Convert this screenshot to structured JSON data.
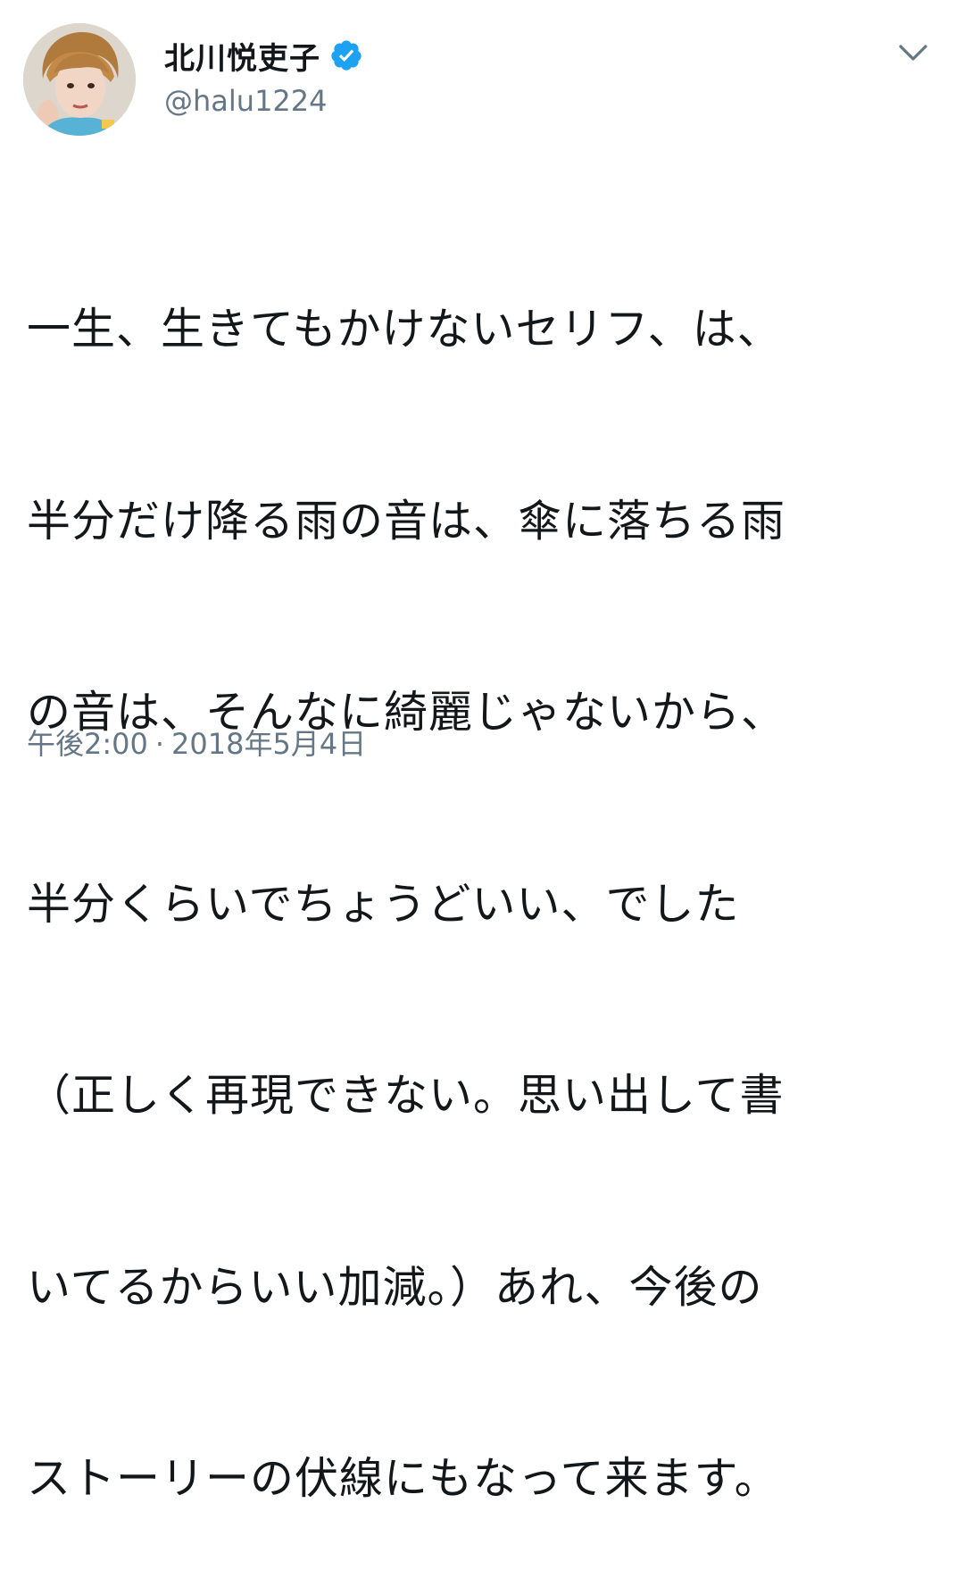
{
  "user": {
    "display_name": "北川悦吏子",
    "handle": "@halu1224",
    "verified": true
  },
  "tweet": {
    "lines": [
      "一生、生きてもかけないセリフ、は、",
      "半分だけ降る雨の音は、傘に落ちる雨",
      "の音は、そんなに綺麗じゃないから、",
      "半分くらいでちょうどいい、でした",
      "（正しく再現できない。思い出して書",
      "いてるからいい加減。）あれ、今後の",
      "ストーリーの伏線にもなって来ます。"
    ],
    "time": "午後2:00",
    "separator": "·",
    "date": "2018年5月4日"
  },
  "colors": {
    "text": "#14171a",
    "secondary": "#657786",
    "verified_blue": "#1da1f2",
    "background": "#ffffff"
  },
  "icons": {
    "verified": "verified-badge-icon",
    "menu": "chevron-down-icon"
  }
}
